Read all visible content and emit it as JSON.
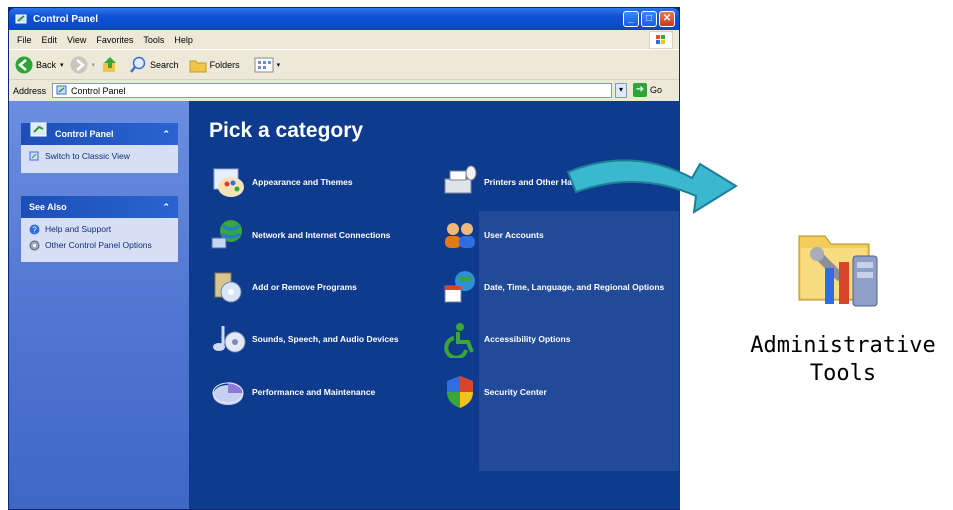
{
  "window": {
    "title": "Control Panel"
  },
  "menu": [
    "File",
    "Edit",
    "View",
    "Favorites",
    "Tools",
    "Help"
  ],
  "toolbar": {
    "back_label": "Back",
    "search_label": "Search",
    "folders_label": "Folders"
  },
  "address": {
    "label": "Address",
    "value": "Control Panel",
    "go_label": "Go"
  },
  "sidebar": {
    "panel_title": "Control Panel",
    "switch_view": "Switch to Classic View",
    "see_also_title": "See Also",
    "see_also_items": [
      "Help and Support",
      "Other Control Panel Options"
    ]
  },
  "main": {
    "heading": "Pick a category",
    "categories": [
      "Appearance and Themes",
      "Printers and Other Hardware",
      "Network and Internet Connections",
      "User Accounts",
      "Add or Remove Programs",
      "Date, Time, Language, and Regional Options",
      "Sounds, Speech, and Audio Devices",
      "Accessibility Options",
      "Performance and Maintenance",
      "Security Center"
    ]
  },
  "callout": {
    "label_line1": "Administrative",
    "label_line2": "Tools"
  },
  "colors": {
    "title_blue": "#0b52d8",
    "main_bg": "#0f3b8e",
    "arrow_teal": "#3bb8d0"
  }
}
